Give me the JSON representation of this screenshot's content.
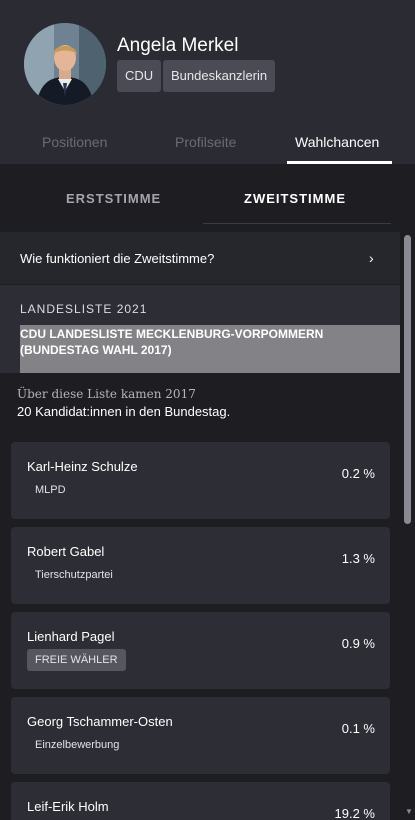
{
  "profile": {
    "name": "Angela Merkel",
    "party_tag": "CDU",
    "role_tag": "Bundeskanzlerin",
    "avatar_icon": "person-photo"
  },
  "profile_tabs": [
    {
      "label": "Positionen",
      "active": false
    },
    {
      "label": "Profilseite",
      "active": false
    },
    {
      "label": "Wahlchancen",
      "active": true
    }
  ],
  "vote_tabs": [
    {
      "label": "ERSTSTIMME",
      "active": false
    },
    {
      "label": "ZWEITSTIMME",
      "active": true
    }
  ],
  "info": {
    "label": "Wie funktioniert die Zweitstimme?",
    "chevron": "›"
  },
  "list": {
    "label": "LANDESLISTE 2021",
    "name": "CDU LANDESLISTE MECKLENBURG-VORPOMMERN (BUNDESTAG WAHL 2017)"
  },
  "note": {
    "line1": "Über diese Liste kamen 2017",
    "line2": "20 Kandidat:innen in den Bundestag."
  },
  "candidates": [
    {
      "name": "Karl-Heinz Schulze",
      "party": "MLPD",
      "percent": "0.2 %"
    },
    {
      "name": "Robert Gabel",
      "party": "Tierschutzpartei",
      "percent": "1.3 %"
    },
    {
      "name": "Lienhard Pagel",
      "party": "FREIE WÄHLER",
      "percent": "0.9 %"
    },
    {
      "name": "Georg Tschammer-Osten",
      "party": "Einzelbewerbung",
      "percent": "0.1 %"
    },
    {
      "name": "Leif-Erik Holm",
      "party": "",
      "percent": "19.2 %"
    }
  ],
  "colors": {
    "background": "#1d1d22",
    "header": "#2b2b33",
    "card": "#2d2d35",
    "tag": "#4b4b55",
    "accent": "#ffffff"
  }
}
